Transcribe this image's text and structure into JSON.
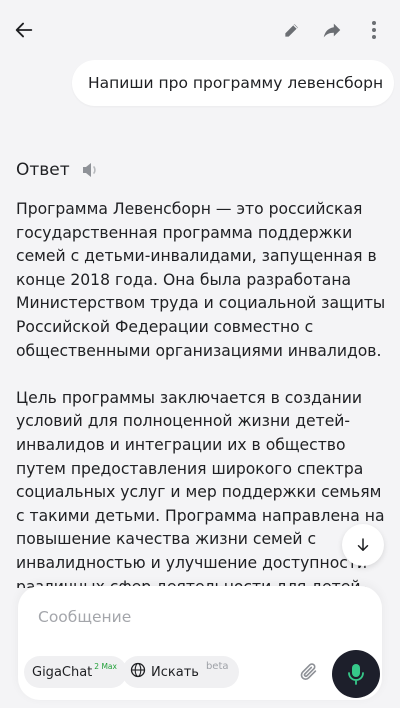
{
  "user_message": "Напиши про программу левенсборн",
  "answer": {
    "title": "Ответ",
    "paragraphs": [
      "Программа Левенсборн — это российская государственная программа поддержки семей с детьми-инвалидами, запущенная в конце 2018 года. Она была разработана Министерством труда и социальной защиты Российской Федерации совместно с общественными организациями инвалидов.",
      "Цель программы заключается в создании условий для полноценной жизни детей-инвалидов и интеграции их в общество путем предоставления широкого спектра социальных услуг и мер поддержки семьям с такими детьми. Программа направлена на повышение качества жизни семей с инвалидностью и улучшение доступности различных сфер деятельности для детей-"
    ]
  },
  "composer": {
    "placeholder": "Сообщение",
    "model_chip": {
      "label": "GigaChat",
      "badge": "2 Max"
    },
    "search_chip": {
      "label": "Искать",
      "badge": "beta"
    }
  },
  "icons": {
    "back": "arrow-left-icon",
    "edit": "pencil-icon",
    "share": "share-arrow-icon",
    "more": "more-vertical-icon",
    "speaker": "speaker-icon",
    "scroll_down": "arrow-down-icon",
    "attach": "paperclip-icon",
    "mic": "microphone-icon"
  },
  "colors": {
    "background": "#f4f4f6",
    "mic_button": "#1d1f2b",
    "mic_icon": "#36c98a",
    "badge_green": "#21a038"
  }
}
